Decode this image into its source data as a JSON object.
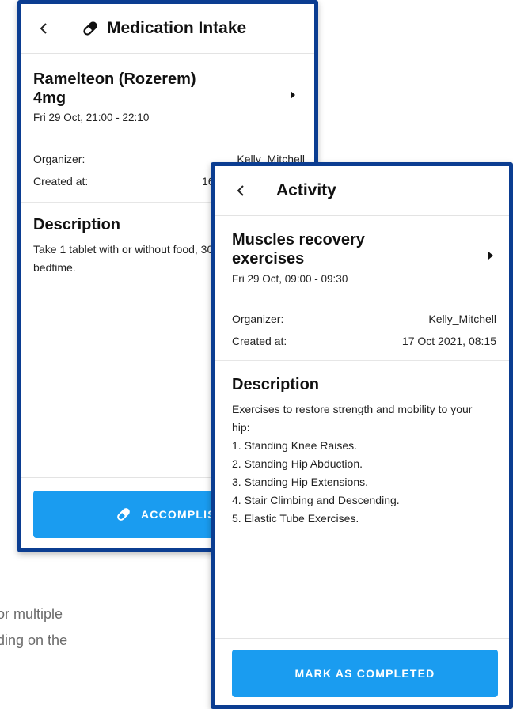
{
  "background_text": {
    "line1": "or multiple",
    "line2": "ding on the",
    "line3": "."
  },
  "medication_screen": {
    "title": "Medication Intake",
    "back_icon": "chevron-left-icon",
    "title_icon": "pill-icon",
    "event_name_line1": "Ramelteon (Rozerem)",
    "event_name_line2": "4mg",
    "event_time": "Fri 29 Oct, 21:00 - 22:10",
    "organizer_label": "Organizer:",
    "organizer_value": "Kelly_Mitchell",
    "created_label": "Created at:",
    "created_value_partial": "16",
    "description_heading": "Description",
    "description_line1": "Take 1 tablet with or without food, 30",
    "description_line2": "bedtime.",
    "action_label": "ACCOMPLISHED",
    "action_icon": "pill-icon"
  },
  "activity_screen": {
    "title": "Activity",
    "back_icon": "chevron-left-icon",
    "event_name_line1": "Muscles recovery",
    "event_name_line2": "exercises",
    "event_time": "Fri 29 Oct, 09:00 - 09:30",
    "organizer_label": "Organizer:",
    "organizer_value": "Kelly_Mitchell",
    "created_label": "Created at:",
    "created_value": "17 Oct 2021, 08:15",
    "description_heading": "Description",
    "description_lines": [
      "Exercises to restore strength and mobility to your",
      "hip:",
      "1. Standing Knee Raises.",
      "2. Standing Hip Abduction.",
      "3. Standing Hip Extensions.",
      "4. Stair Climbing and Descending.",
      "5. Elastic Tube Exercises."
    ],
    "action_label": "MARK AS COMPLETED"
  },
  "colors": {
    "frame_border": "#0b3d91",
    "accent_button": "#1a9cf0"
  }
}
